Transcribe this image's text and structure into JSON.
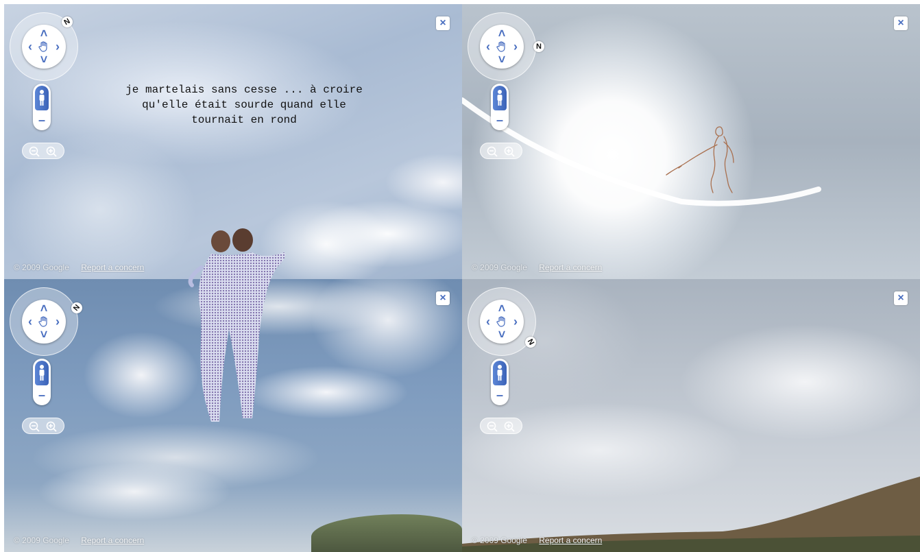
{
  "panes": [
    {
      "id": "top-left",
      "north": "N",
      "close_label": "×",
      "copyright": "© 2009 Google",
      "report_link": "Report a concern",
      "overlay_text": "je martelais sans cesse ... à croire\nqu'elle était sourde quand elle\ntournait en rond"
    },
    {
      "id": "top-right",
      "north": "N",
      "close_label": "×",
      "copyright": "© 2009 Google",
      "report_link": "Report a concern"
    },
    {
      "id": "bottom-left",
      "north": "N",
      "close_label": "×",
      "copyright": "© 2009 Google",
      "report_link": "Report a concern"
    },
    {
      "id": "bottom-right",
      "north": "N",
      "close_label": "×",
      "copyright": "© 2009 Google",
      "report_link": "Report a concern"
    }
  ],
  "controls": {
    "up": "˄",
    "down": "˅",
    "left": "‹",
    "right": "›",
    "minus": "–"
  },
  "icons": {
    "pan": "hand-icon",
    "pegman": "pegman-icon",
    "zoom_out": "zoom-out-icon",
    "zoom_in": "zoom-in-icon",
    "close": "close-icon"
  },
  "colors": {
    "accent": "#4a6fc0",
    "pegman": "#3c63b8"
  }
}
